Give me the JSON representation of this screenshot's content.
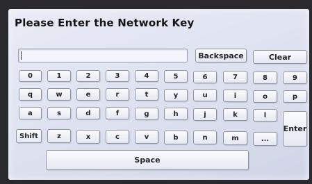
{
  "title": "Please Enter the Network Key",
  "input": {
    "value": ""
  },
  "buttons": {
    "backspace": "Backspace",
    "clear": "Clear",
    "enter": "Enter",
    "shift": "Shift",
    "space": "Space"
  },
  "rows": {
    "numbers": [
      "0",
      "1",
      "2",
      "3",
      "4",
      "5",
      "6",
      "7",
      "8",
      "9"
    ],
    "top": [
      "q",
      "w",
      "e",
      "r",
      "t",
      "y",
      "u",
      "i",
      "o",
      "p"
    ],
    "middle": [
      "a",
      "s",
      "d",
      "f",
      "g",
      "h",
      "j",
      "k",
      "l"
    ],
    "bottom": [
      "z",
      "x",
      "c",
      "v",
      "b",
      "n",
      "m",
      "..."
    ]
  }
}
